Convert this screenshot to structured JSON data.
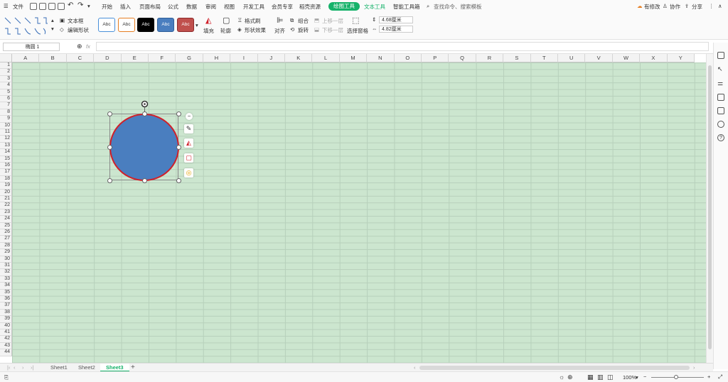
{
  "menubar": {
    "file": "文件",
    "tabs": [
      {
        "label": "开始"
      },
      {
        "label": "插入"
      },
      {
        "label": "页面布局"
      },
      {
        "label": "公式"
      },
      {
        "label": "数据"
      },
      {
        "label": "审阅"
      },
      {
        "label": "视图"
      },
      {
        "label": "开发工具"
      },
      {
        "label": "会员专享"
      },
      {
        "label": "稻壳资源"
      }
    ],
    "active_tab": "绘图工具",
    "text_tool_tab": "文本工具",
    "smart_tab": "智能工具箱",
    "search": "查找命令、搜索模板",
    "unsaved": "有修改",
    "collab": "协作",
    "share": "分享"
  },
  "ribbon": {
    "textbox": "文本框",
    "edit_shape": "编辑形状",
    "style_label": "Abc",
    "fill": "填充",
    "outline": "轮廓",
    "format_brush": "格式刷",
    "shape_effect": "形状效果",
    "align": "对齐",
    "group": "组合",
    "rotate": "旋转",
    "bring_forward": "上移一层",
    "send_backward": "下移一层",
    "select_pane": "选择窗格",
    "height": "4.68厘米",
    "width": "4.82厘米"
  },
  "formulabar": {
    "name_box": "椭圆 1",
    "fx": "fx"
  },
  "columns": [
    "A",
    "B",
    "C",
    "D",
    "E",
    "F",
    "G",
    "H",
    "I",
    "J",
    "K",
    "L",
    "M",
    "N",
    "O",
    "P",
    "Q",
    "R",
    "S",
    "T",
    "U",
    "V",
    "W",
    "X",
    "Y"
  ],
  "rows": [
    "1",
    "2",
    "3",
    "4",
    "5",
    "6",
    "7",
    "8",
    "9",
    "10",
    "11",
    "12",
    "13",
    "14",
    "15",
    "16",
    "17",
    "18",
    "19",
    "20",
    "21",
    "22",
    "23",
    "24",
    "25",
    "26",
    "27",
    "28",
    "29",
    "30",
    "31",
    "32",
    "33",
    "34",
    "35",
    "36",
    "37",
    "38",
    "39",
    "40",
    "41",
    "42",
    "43",
    "44"
  ],
  "sheets": [
    {
      "label": "Sheet1"
    },
    {
      "label": "Sheet2"
    },
    {
      "label": "Sheet3"
    }
  ],
  "active_sheet": "Sheet3",
  "statusbar": {
    "zoom": "100%"
  },
  "colors": {
    "accent": "#16b26a",
    "grid_bg": "#cce6cf",
    "shape_fill": "#4a7ebf",
    "shape_outline": "#d0202a"
  },
  "icons": [
    "menu-icon",
    "save-icon",
    "print-icon",
    "undo-icon",
    "redo-icon",
    "search-icon",
    "cloud-icon",
    "user-icon",
    "share-icon",
    "zoom-icon",
    "fx-icon",
    "plus-icon",
    "minus-icon"
  ]
}
